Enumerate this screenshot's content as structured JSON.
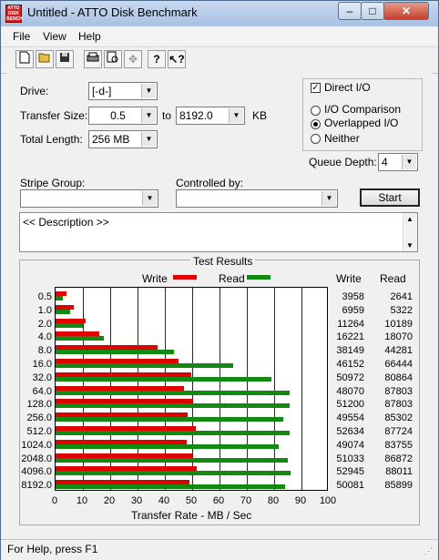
{
  "window": {
    "title": "Untitled - ATTO Disk Benchmark",
    "icon_text": "ATTO DISK BENCH",
    "controls": {
      "minimize": "–",
      "maximize": "□",
      "close": "✕"
    }
  },
  "menu": [
    "File",
    "View",
    "Help"
  ],
  "toolbar": [
    "new-doc-icon",
    "open-folder-icon",
    "save-icon",
    "print-icon",
    "print-preview-icon",
    "move-icon",
    "help-icon",
    "context-help-icon"
  ],
  "form": {
    "drive_label": "Drive:",
    "drive_value": "[-d-]",
    "transfer_size_label": "Transfer Size:",
    "transfer_from": "0.5",
    "to_label": "to",
    "transfer_to": "8192.0",
    "kb_label": "KB",
    "total_length_label": "Total Length:",
    "total_length_value": "256 MB",
    "direct_io_label": "Direct I/O",
    "direct_io_checked": true,
    "io_options": [
      "I/O Comparison",
      "Overlapped I/O",
      "Neither"
    ],
    "io_selected": "Overlapped I/O",
    "queue_depth_label": "Queue Depth:",
    "queue_depth_value": "4",
    "stripe_group_label": "Stripe Group:",
    "stripe_group_value": "",
    "controlled_by_label": "Controlled by:",
    "controlled_by_value": "",
    "start_label": "Start",
    "description": "<< Description >>"
  },
  "results": {
    "group_title": "Test Results",
    "legend_write": "Write",
    "legend_read": "Read",
    "col_write": "Write",
    "col_read": "Read"
  },
  "chart_data": {
    "type": "bar",
    "orientation": "horizontal",
    "categories": [
      "0.5",
      "1.0",
      "2.0",
      "4.0",
      "8.0",
      "16.0",
      "32.0",
      "64.0",
      "128.0",
      "256.0",
      "512.0",
      "1024.0",
      "2048.0",
      "4096.0",
      "8192.0"
    ],
    "series": [
      {
        "name": "Write",
        "color": "#e00000",
        "values": [
          3958,
          6959,
          11264,
          16221,
          38149,
          46152,
          50972,
          48070,
          51200,
          49554,
          52634,
          49074,
          51033,
          52945,
          50081
        ]
      },
      {
        "name": "Read",
        "color": "#128a12",
        "values": [
          2641,
          5322,
          10189,
          18070,
          44281,
          66444,
          80864,
          87803,
          87803,
          85302,
          87724,
          83755,
          86872,
          88011,
          85899
        ]
      }
    ],
    "values_unit_note": "KB/s",
    "xlabel": "Transfer Rate - MB / Sec",
    "xlim": [
      0,
      100
    ],
    "xticks": [
      "0",
      "10",
      "20",
      "30",
      "40",
      "50",
      "60",
      "70",
      "80",
      "90",
      "100"
    ],
    "grid": true,
    "legend": "top"
  },
  "status": {
    "text": "For Help, press F1"
  }
}
